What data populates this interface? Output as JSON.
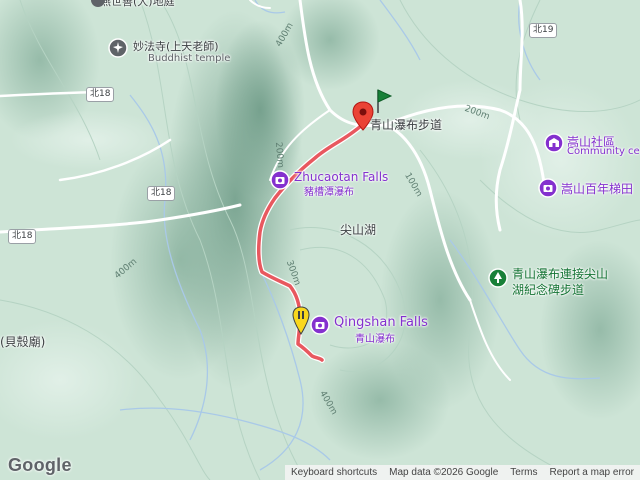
{
  "labels": {
    "top_cut": "燕世善(大)地庭",
    "miaofa_temple": "妙法寺(上天老師)",
    "buddhist_temple": "Buddhist temple",
    "qingshan_trail": "青山瀑布步道",
    "zhucaotan_falls": "Zhucaotan Falls",
    "zhucaotan_zh": "豬槽潭瀑布",
    "jianshan_lake": "尖山湖",
    "qingshan_falls": "Qingshan Falls",
    "qingshan_falls_zh": "青山瀑布",
    "song_community": "嵩山社區",
    "community_center": "Community ce",
    "song_terraces": "嵩山百年梯田",
    "connect_trail_1": "青山瀑布連接尖山",
    "connect_trail_2": "湖紀念碑步道",
    "beike_temple": "(貝殼廟)"
  },
  "roads": {
    "bei18_a": "北18",
    "bei18_b": "北18",
    "bei18_c": "北18",
    "bei19": "北19"
  },
  "contours": {
    "c200_a": "200m",
    "c200_b": "200m",
    "c300": "300m",
    "c400_a": "400m",
    "c400_b": "400m",
    "c400_c": "400m",
    "c100": "100m"
  },
  "branding": {
    "logo": "Google"
  },
  "attribution": {
    "shortcuts": "Keyboard shortcuts",
    "map_data": "Map data ©2026 Google",
    "terms": "Terms",
    "report": "Report a map error"
  },
  "colors": {
    "route": "#e8585f",
    "start_marker": "#ea4335",
    "flag_marker": "#188038",
    "yellow_marker": "#f9d71c",
    "poi_purple": "#8430ce",
    "poi_green": "#137333"
  },
  "icons": [
    "camera-icon",
    "building-icon",
    "tree-icon",
    "temple-icon",
    "flag-icon",
    "map-pin-icon"
  ]
}
